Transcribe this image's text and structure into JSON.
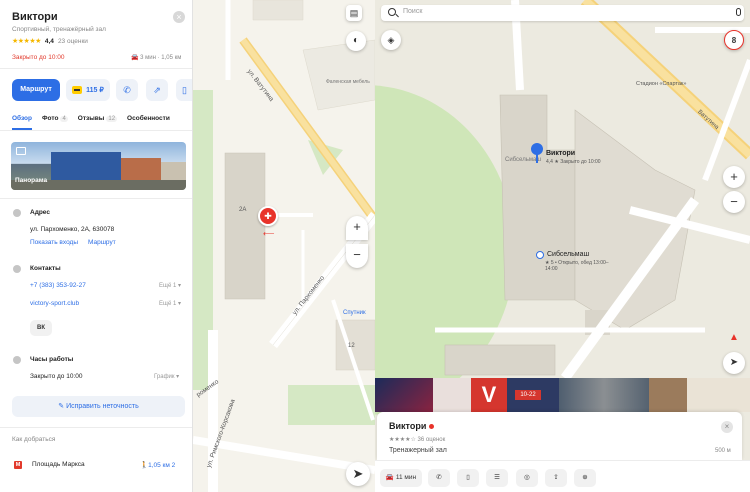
{
  "left": {
    "title": "Виктори",
    "subtitle": "Спортивный, тренажёрный зал",
    "stars": "★★★★★",
    "rating": "4,4",
    "reviews": "23 оценки",
    "status": "Закрыто до 10:00",
    "travel": "3 мин · 1,05 км",
    "route_label": "Маршрут",
    "pay_label": "115 ₽",
    "tabs": [
      {
        "label": "Обзор",
        "count": ""
      },
      {
        "label": "Фото",
        "count": "4"
      },
      {
        "label": "Отзывы",
        "count": "12"
      },
      {
        "label": "Особенности",
        "count": ""
      }
    ],
    "panorama_label": "Панорама",
    "address_title": "Адрес",
    "address": "ул. Пархоменко, 2А, 630078",
    "show_entrances": "Показать входы",
    "route_link": "Маршрут",
    "contacts_title": "Контакты",
    "phone": "+7 (383) 353-92-27",
    "site": "victory-sport.club",
    "more": "Ещё 1",
    "vk": "ВК",
    "hours_title": "Часы работы",
    "hours": "Закрыто до 10:00",
    "schedule": "График",
    "fix_label": "Исправить неточность",
    "howto": "Как добраться",
    "metro_letter": "М",
    "metro_name": "Площадь Маркса",
    "metro_dist": "1,05 км  2"
  },
  "mid": {
    "streets": [
      "ул. Ватутина",
      "ул. Пархоменко",
      "ул. Римского-Корсакова",
      "роменко"
    ],
    "labels": [
      "2А",
      "12",
      "Спутник",
      "Фаленская мебель"
    ],
    "zoom_in": "+",
    "zoom_out": "−"
  },
  "right": {
    "search_placeholder": "Поиск",
    "map_labels": [
      {
        "text": "Стадион «Спартак»"
      },
      {
        "text": "Сибсельмаш"
      },
      {
        "text": "Ватутина"
      }
    ],
    "pin_name": "Виктори",
    "pin_sub": "4,4 ★ Закрыто до 10:00",
    "poi2_name": "Сибсельмаш",
    "poi2_sub": "★ 5 • Открыто, обед 13:00–14:00",
    "zoom_level": "8",
    "card": {
      "title": "Виктори",
      "rating": "★★★★☆ 36 оценок",
      "type": "Тренажерный зал",
      "dist": "500 м",
      "photo_text": "10-22"
    },
    "bottom": {
      "time": "11 мин"
    }
  }
}
